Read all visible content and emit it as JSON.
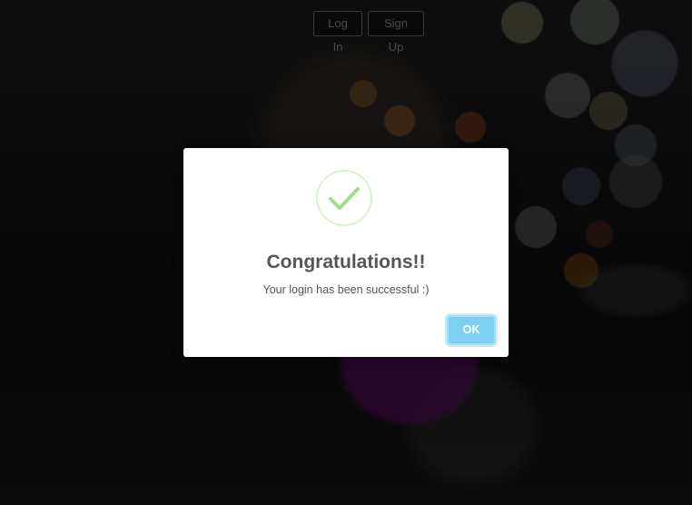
{
  "nav": {
    "login_label": "Log In",
    "signup_label": "Sign Up"
  },
  "modal": {
    "icon": "checkmark-icon",
    "title": "Congratulations!!",
    "message": "Your login has been successful :)",
    "ok_label": "OK"
  },
  "colors": {
    "success_green": "#a5dc86",
    "ok_button": "#7cd1f2",
    "text": "#555555"
  }
}
